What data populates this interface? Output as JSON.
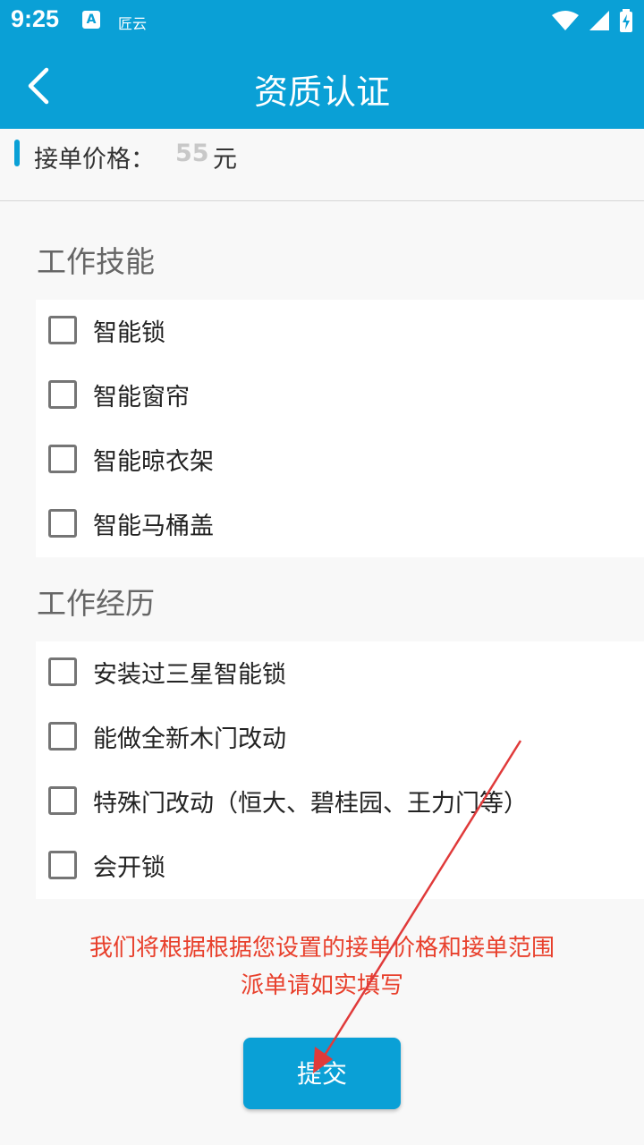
{
  "status_bar": {
    "time": "9:25",
    "app_icon_letter": "A",
    "app_label": "匠云",
    "icons": [
      "wifi-icon",
      "cellular-signal-icon",
      "battery-charging-icon"
    ]
  },
  "app_bar": {
    "title": "资质认证",
    "back_icon": "chevron-left-icon"
  },
  "price": {
    "label": "接单价格：",
    "value": "55",
    "unit": "元"
  },
  "skills": {
    "title": "工作技能",
    "options": [
      {
        "label": "智能锁",
        "checked": false
      },
      {
        "label": "智能窗帘",
        "checked": false
      },
      {
        "label": "智能晾衣架",
        "checked": false
      },
      {
        "label": "智能马桶盖",
        "checked": false
      }
    ]
  },
  "experience": {
    "title": "工作经历",
    "options": [
      {
        "label": "安装过三星智能锁",
        "checked": false
      },
      {
        "label": "能做全新木门改动",
        "checked": false
      },
      {
        "label": "特殊门改动（恒大、碧桂园、王力门等）",
        "checked": false
      },
      {
        "label": "会开锁",
        "checked": false
      }
    ]
  },
  "notice": {
    "line1": "我们将根据根据您设置的接单价格和接单范围",
    "line2": "派单请如实填写"
  },
  "submit_label": "提交",
  "colors": {
    "primary": "#0aa0d6",
    "notice": "#e8402c",
    "annotation_arrow": "#e03a3a"
  }
}
